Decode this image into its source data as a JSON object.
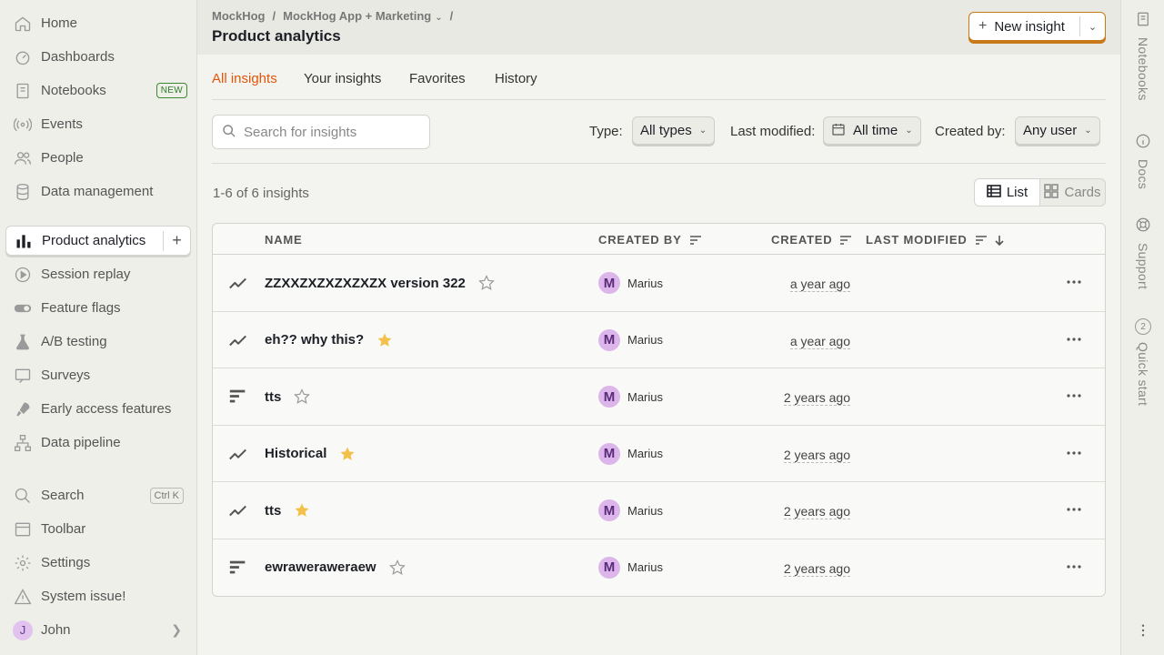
{
  "sidebar": {
    "items": [
      {
        "label": "Home",
        "icon": "home-icon"
      },
      {
        "label": "Dashboards",
        "icon": "dashboard-icon"
      },
      {
        "label": "Notebooks",
        "icon": "notebook-icon",
        "badge": "NEW"
      },
      {
        "label": "Events",
        "icon": "events-icon"
      },
      {
        "label": "People",
        "icon": "people-icon"
      },
      {
        "label": "Data management",
        "icon": "database-icon"
      },
      {
        "label": "Product analytics",
        "icon": "bar-chart-icon",
        "active": true
      },
      {
        "label": "Session replay",
        "icon": "play-icon"
      },
      {
        "label": "Feature flags",
        "icon": "toggle-icon"
      },
      {
        "label": "A/B testing",
        "icon": "flask-icon"
      },
      {
        "label": "Surveys",
        "icon": "survey-icon"
      },
      {
        "label": "Early access features",
        "icon": "rocket-icon"
      },
      {
        "label": "Data pipeline",
        "icon": "pipeline-icon"
      }
    ],
    "bottom": [
      {
        "label": "Search",
        "icon": "search-icon",
        "shortcut": "Ctrl K"
      },
      {
        "label": "Toolbar",
        "icon": "toolbar-icon"
      },
      {
        "label": "Settings",
        "icon": "gear-icon"
      },
      {
        "label": "System issue!",
        "icon": "warning-icon"
      }
    ],
    "user": {
      "initial": "J",
      "name": "John"
    }
  },
  "header": {
    "breadcrumb": [
      "MockHog",
      "MockHog App + Marketing",
      "/"
    ],
    "title": "Product analytics",
    "new_insight_label": "New insight"
  },
  "tabs": [
    "All insights",
    "Your insights",
    "Favorites",
    "History"
  ],
  "active_tab": "All insights",
  "filters": {
    "search_placeholder": "Search for insights",
    "type_label": "Type:",
    "type_value": "All types",
    "modified_label": "Last modified:",
    "modified_value": "All time",
    "created_by_label": "Created by:",
    "created_by_value": "Any user"
  },
  "results_count": "1-6 of 6 insights",
  "view_toggle": {
    "list": "List",
    "cards": "Cards",
    "active": "List"
  },
  "table": {
    "columns": [
      "NAME",
      "CREATED BY",
      "CREATED",
      "LAST MODIFIED"
    ],
    "rows": [
      {
        "type": "trend",
        "name": "ZZXXZXZXZXZXZX version 322",
        "favorited": false,
        "creator": "Marius",
        "creator_initial": "M",
        "created": "a year ago"
      },
      {
        "type": "trend",
        "name": "eh?? why this?",
        "favorited": true,
        "creator": "Marius",
        "creator_initial": "M",
        "created": "a year ago"
      },
      {
        "type": "funnel",
        "name": "tts",
        "favorited": false,
        "creator": "Marius",
        "creator_initial": "M",
        "created": "2 years ago"
      },
      {
        "type": "trend",
        "name": "Historical",
        "favorited": true,
        "creator": "Marius",
        "creator_initial": "M",
        "created": "2 years ago"
      },
      {
        "type": "trend",
        "name": "tts",
        "favorited": true,
        "creator": "Marius",
        "creator_initial": "M",
        "created": "2 years ago"
      },
      {
        "type": "funnel",
        "name": "ewraweraweraew",
        "favorited": false,
        "creator": "Marius",
        "creator_initial": "M",
        "created": "2 years ago"
      }
    ]
  },
  "right_rail": [
    {
      "label": "Notebooks",
      "icon": "notebook-icon"
    },
    {
      "label": "Docs",
      "icon": "info-icon"
    },
    {
      "label": "Support",
      "icon": "lifebuoy-icon"
    },
    {
      "label": "Quick start",
      "icon": "progress-icon",
      "count": "2"
    }
  ],
  "colors": {
    "accent": "#e0560b",
    "star": "#f3c04a",
    "new_insight_border": "#c8791a"
  }
}
